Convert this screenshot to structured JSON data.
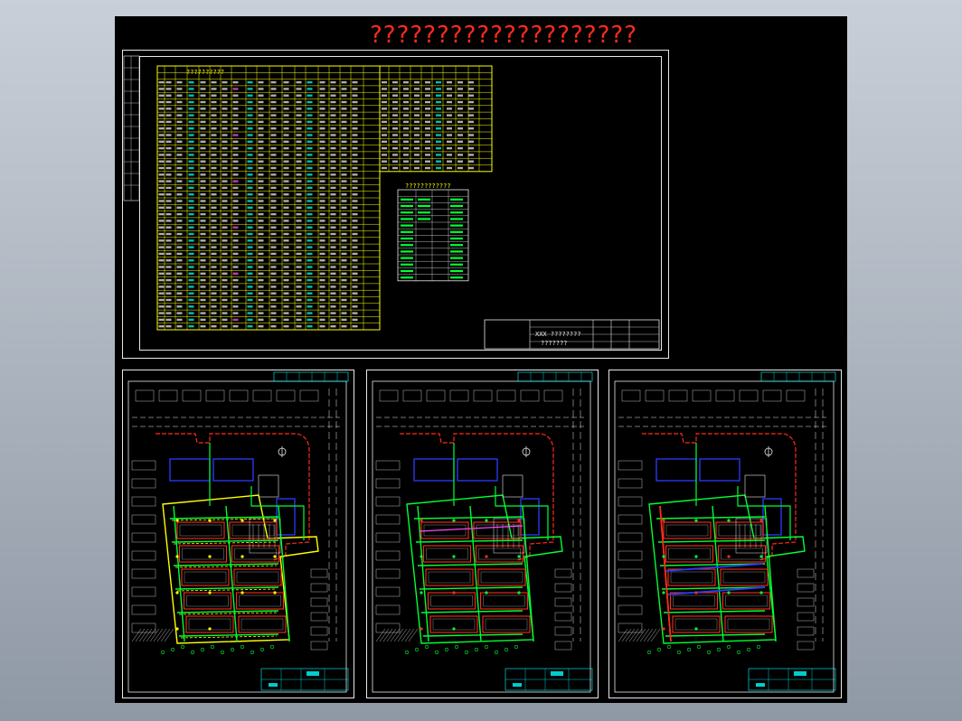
{
  "drawing": {
    "title": "????????????????????",
    "table_caption": "??????????",
    "legend_caption": "????????????",
    "title_block_name": "???????",
    "title_block_row": "XXX ????????"
  },
  "colors": {
    "background": "#000000",
    "title": "#ff2a1a",
    "table_lines": "#ffff00",
    "road": "#ff2a1a",
    "building_blue": "#2a3cff",
    "pipe_green": "#00ff33",
    "pipe_yellow": "#ffff00",
    "border": "#e8e8e8",
    "title_block_cyan": "#00ffff"
  },
  "sheets": [
    {
      "id": "plan-1",
      "variant": "water-supply"
    },
    {
      "id": "plan-2",
      "variant": "drainage"
    },
    {
      "id": "plan-3",
      "variant": "heating"
    }
  ]
}
